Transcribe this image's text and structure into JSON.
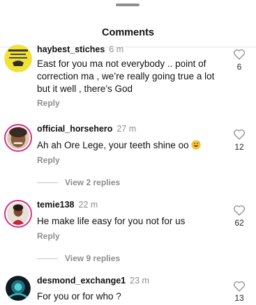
{
  "header": {
    "title": "Comments"
  },
  "comments": [
    {
      "username": "haybest_stiches",
      "time": "6 m",
      "text": "East for you ma not everybody .. point of correction ma , we’re really going true a lot but it well , there’s God",
      "reply_label": "Reply",
      "likes": "6"
    },
    {
      "username": "official_horsehero",
      "time": "27 m",
      "text": "Ah ah Ore Lege, your teeth shine oo",
      "reply_label": "Reply",
      "likes": "12",
      "view_replies": "View 2 replies"
    },
    {
      "username": "temie138",
      "time": "22 m",
      "text": "He make life easy for you not for us",
      "reply_label": "Reply",
      "likes": "62",
      "view_replies": "View 9 replies"
    },
    {
      "username": "desmond_exchange1",
      "time": "23 m",
      "text": "For you or for who ?",
      "likes": "13"
    }
  ],
  "colors": {
    "story_ring": "#d43089",
    "muted_text": "#8e8e8e"
  },
  "icons": {
    "like": "heart-outline-icon",
    "emoji": "grinning-sweat-emoji"
  }
}
